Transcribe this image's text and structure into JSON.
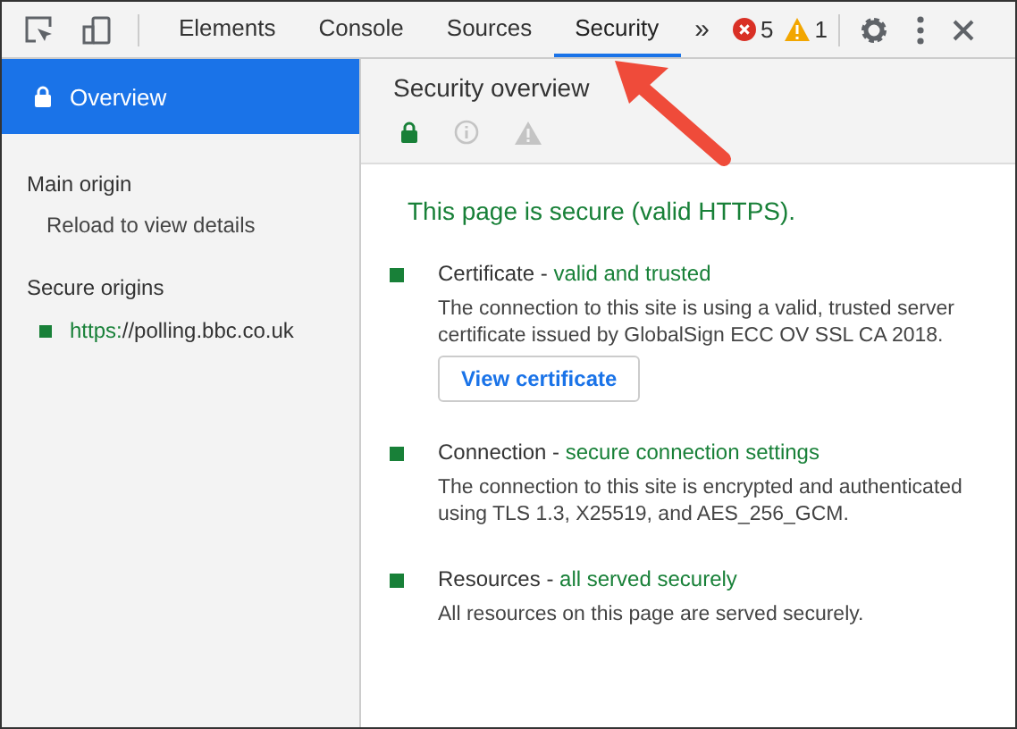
{
  "toolbar": {
    "tabs": [
      {
        "label": "Elements",
        "selected": false
      },
      {
        "label": "Console",
        "selected": false
      },
      {
        "label": "Sources",
        "selected": false
      },
      {
        "label": "Security",
        "selected": true
      }
    ],
    "overflow": "»",
    "errors": "5",
    "warnings": "1"
  },
  "sidebar": {
    "overview": {
      "label": "Overview",
      "selected": true
    },
    "sections": [
      {
        "title": "Main origin",
        "items": [
          {
            "kind": "note",
            "text": "Reload to view details"
          }
        ]
      },
      {
        "title": "Secure origins",
        "items": [
          {
            "kind": "origin",
            "scheme": "https:",
            "host": "//polling.bbc.co.uk",
            "color": "#188038"
          }
        ]
      }
    ]
  },
  "main": {
    "title": "Security overview",
    "icon_tabs": [
      {
        "kind": "lock",
        "selected": true
      },
      {
        "kind": "info",
        "selected": false
      },
      {
        "kind": "warning",
        "selected": false
      }
    ],
    "summary": "This page is secure (valid HTTPS).",
    "items": [
      {
        "title": "Certificate -",
        "status": "valid and trusted",
        "color": "#188038",
        "description": "The connection to this site is using a valid, trusted server certificate issued by GlobalSign ECC OV SSL CA 2018.",
        "button": "View certificate"
      },
      {
        "title": "Connection -",
        "status": "secure connection settings",
        "color": "#188038",
        "description": "The connection to this site is encrypted and authenticated using TLS 1.3, X25519, and AES_256_GCM."
      },
      {
        "title": "Resources -",
        "status": "all served securely",
        "color": "#188038",
        "description": "All resources on this page are served securely."
      }
    ]
  }
}
